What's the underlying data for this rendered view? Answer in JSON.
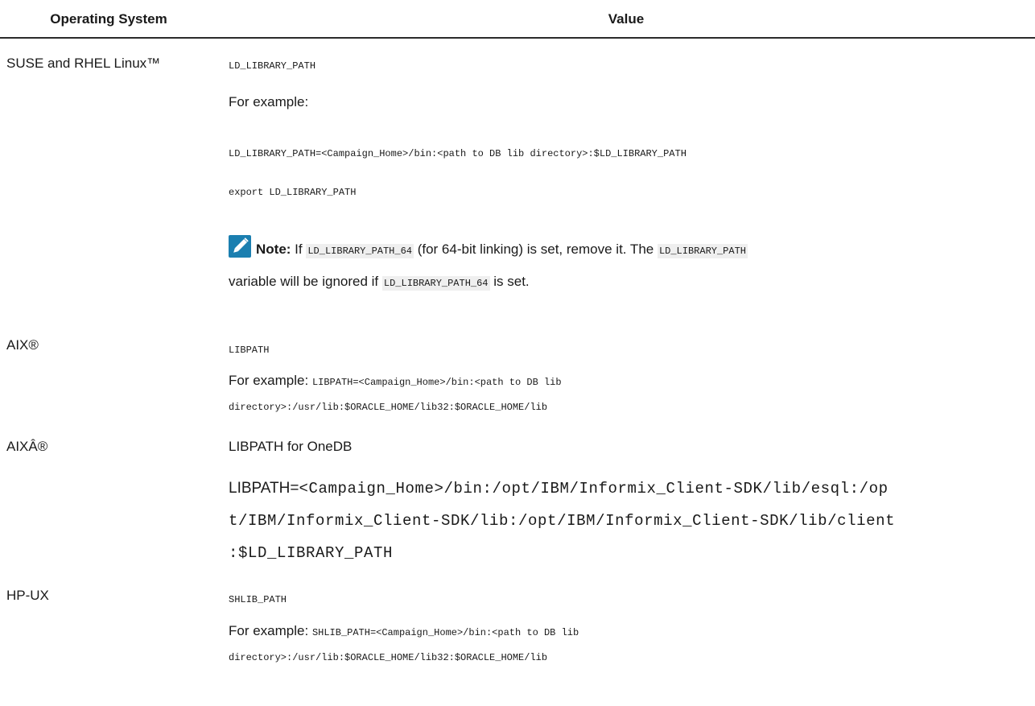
{
  "table": {
    "header": {
      "os": "Operating System",
      "value": "Value"
    },
    "rows": {
      "suse": {
        "os": "SUSE and RHEL Linux™",
        "var": "LD_LIBRARY_PATH",
        "example_label": "For example:",
        "code1": "LD_LIBRARY_PATH=<Campaign_Home>/bin:<path to DB lib directory>:$LD_LIBRARY_PATH",
        "code2": "export LD_LIBRARY_PATH",
        "note": {
          "label": "Note:",
          "t1": " If ",
          "c1": "LD_LIBRARY_PATH_64",
          "t2": " (for 64-bit linking) is set, remove it. The ",
          "c2": "LD_LIBRARY_PATH",
          "t3": "variable will be ignored if ",
          "c3": "LD_LIBRARY_PATH_64",
          "t4": " is set."
        }
      },
      "aix": {
        "os": "AIX®",
        "var": "LIBPATH",
        "example_label": "For example: ",
        "code1": "LIBPATH=<Campaign_Home>/bin:<path to DB lib",
        "code2": "directory>:/usr/lib:$ORACLE_HOME/lib32:$ORACLE_HOME/lib"
      },
      "aix_onedb": {
        "os": "AIXÂ®",
        "var": "LIBPATH for OneDB",
        "line1_prefix": "LIBPATH=",
        "line1_code": "<Campaign_Home>/bin:/opt/IBM/Informix_Client-SDK/lib/esql:/op",
        "line2": "t/IBM/Informix_Client-SDK/lib:/opt/IBM/Informix_Client-SDK/lib/client",
        "line3": ":$LD_LIBRARY_PATH"
      },
      "hpux": {
        "os": "HP-UX",
        "var": "SHLIB_PATH",
        "example_label": "For example: ",
        "code1": "SHLIB_PATH=<Campaign_Home>/bin:<path to DB lib",
        "code2": "directory>:/usr/lib:$ORACLE_HOME/lib32:$ORACLE_HOME/lib"
      }
    }
  },
  "colors": {
    "note_icon_bg": "#1b7fb0",
    "chip_bg": "#efefef",
    "rule": "#2b2b2b"
  },
  "icons": {
    "note": "pencil-icon"
  }
}
